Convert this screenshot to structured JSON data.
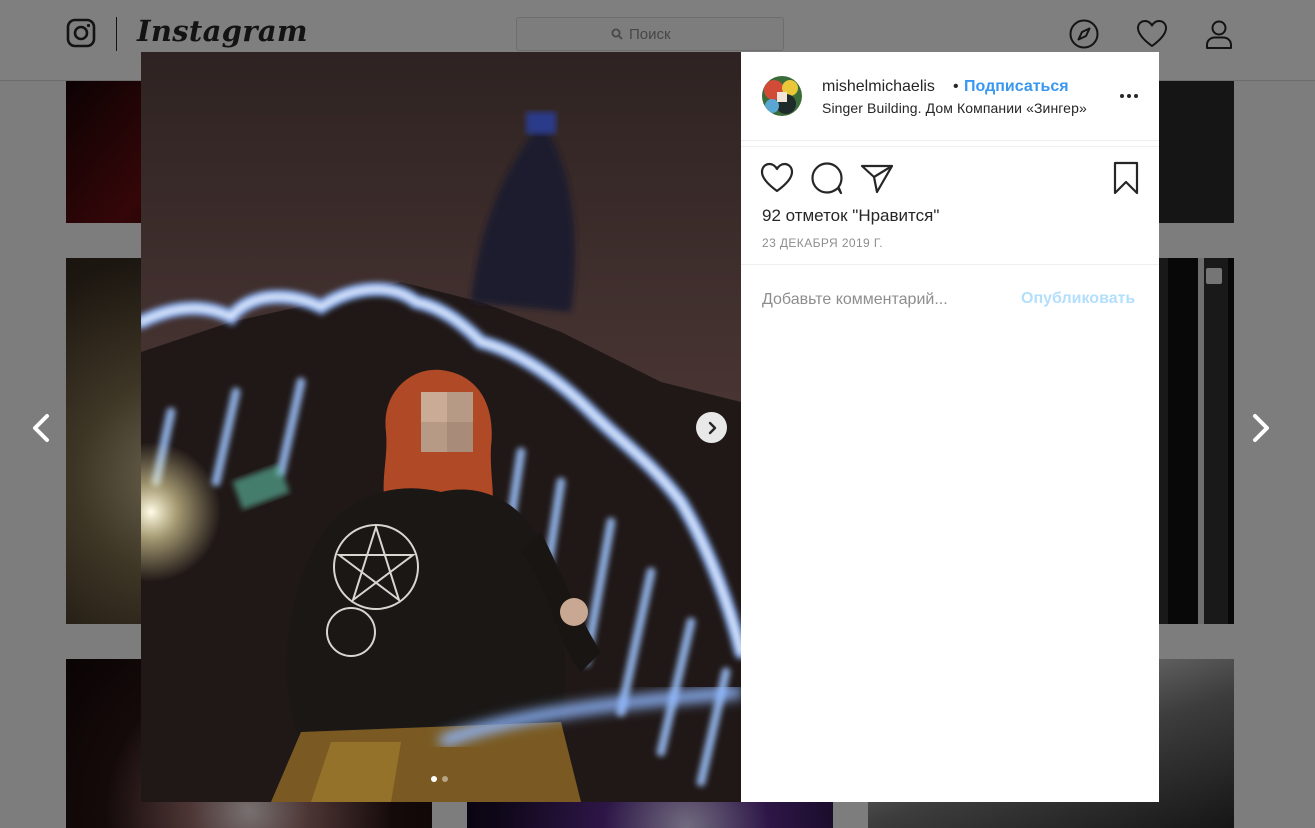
{
  "header": {
    "brand": "Instagram",
    "search_placeholder": "Поиск"
  },
  "post": {
    "username": "mishelmichaelis",
    "bullet": "•",
    "follow_label": "Подписаться",
    "location": "Singer Building. Дом Компании «Зингер»",
    "likes": "92 отметок \"Нравится\"",
    "date": "23 декабря 2019 г.",
    "comment_placeholder": "Добавьте комментарий...",
    "publish_label": "Опубликовать",
    "carousel": {
      "count": 2,
      "active": 1
    }
  },
  "icons": {
    "logo": "instagram-logo-icon",
    "search": "search-icon",
    "explore": "compass-icon",
    "activity": "heart-icon",
    "profile": "user-icon",
    "like": "heart-outline-icon",
    "comment": "comment-bubble-icon",
    "share": "paper-plane-icon",
    "save": "bookmark-icon",
    "more": "ellipsis-icon",
    "prev": "chevron-left-icon",
    "next": "chevron-right-icon"
  },
  "colors": {
    "link_blue": "#3897f0",
    "publish_disabled": "#b2dffc",
    "secondary_text": "#8e8e8e"
  }
}
